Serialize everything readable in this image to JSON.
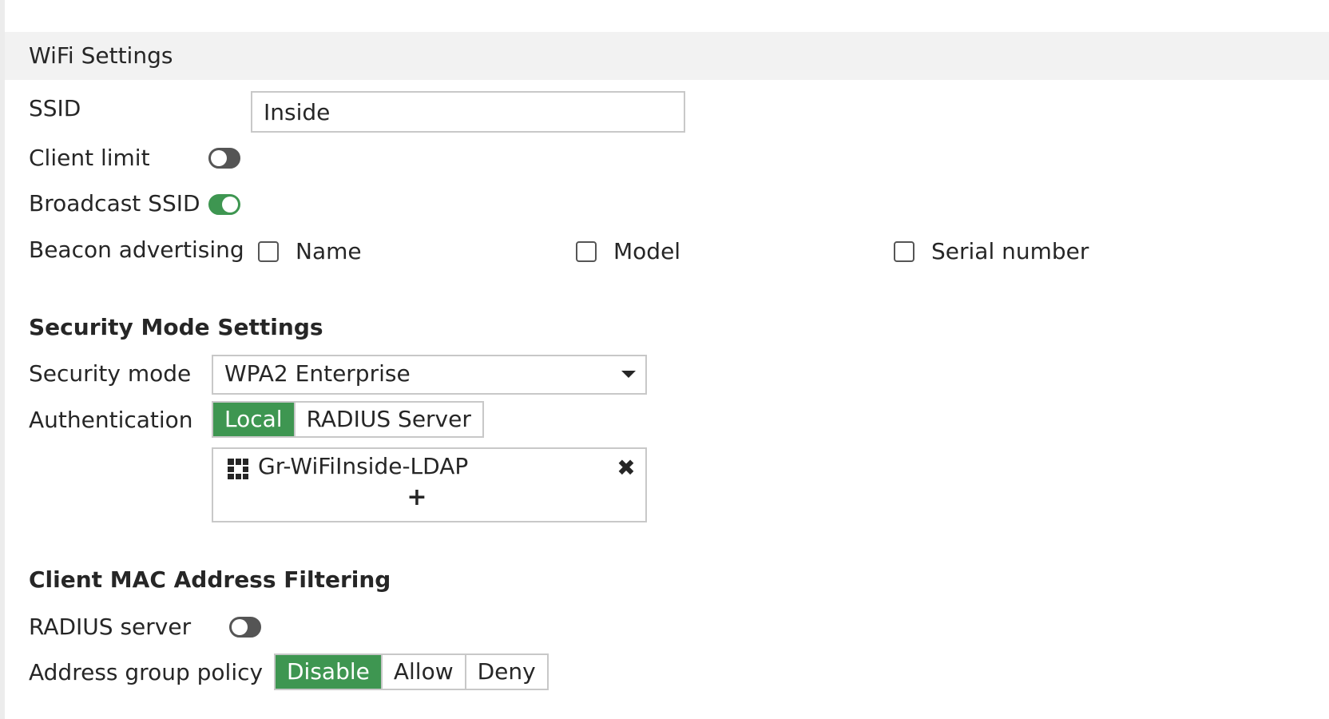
{
  "wifi_settings": {
    "title": "WiFi Settings",
    "ssid": {
      "label": "SSID",
      "value": "Inside"
    },
    "client_limit": {
      "label": "Client limit",
      "enabled": false
    },
    "broadcast_ssid": {
      "label": "Broadcast SSID",
      "enabled": true
    },
    "beacon_advertising": {
      "label": "Beacon advertising",
      "options": [
        {
          "label": "Name",
          "checked": false
        },
        {
          "label": "Model",
          "checked": false
        },
        {
          "label": "Serial number",
          "checked": false
        }
      ]
    }
  },
  "security_mode_settings": {
    "title": "Security Mode Settings",
    "security_mode": {
      "label": "Security mode",
      "value": "WPA2 Enterprise"
    },
    "authentication": {
      "label": "Authentication",
      "options": [
        "Local",
        "RADIUS Server"
      ],
      "selected": "Local"
    },
    "user_groups": {
      "items": [
        "Gr-WiFiInside-LDAP"
      ],
      "add_symbol": "+",
      "remove_symbol": "✖"
    }
  },
  "client_mac_filtering": {
    "title": "Client MAC Address Filtering",
    "radius_server": {
      "label": "RADIUS server",
      "enabled": false
    },
    "address_group_policy": {
      "label": "Address group policy",
      "options": [
        "Disable",
        "Allow",
        "Deny"
      ],
      "selected": "Disable"
    }
  },
  "colors": {
    "accent_green": "#3e9651",
    "toggle_off": "#555555",
    "border": "#c8c8c8",
    "header_bg": "#f2f2f2"
  },
  "icons": {
    "group": "group-icon",
    "remove": "close-icon",
    "add": "plus-icon",
    "dropdown": "chevron-down-icon"
  }
}
